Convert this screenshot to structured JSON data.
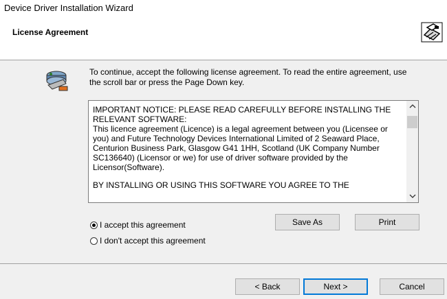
{
  "window": {
    "title": "Device Driver Installation Wizard"
  },
  "header": {
    "title": "License Agreement",
    "icon": "installer-computer-icon"
  },
  "intro": "To continue, accept the following license agreement. To read the entire agreement, use the scroll bar or press the Page Down key.",
  "license": {
    "paragraph1": "IMPORTANT NOTICE: PLEASE READ CAREFULLY BEFORE INSTALLING THE RELEVANT SOFTWARE:\nThis licence agreement (Licence) is a legal agreement between you (Licensee or you) and Future Technology Devices International Limited of 2 Seaward Place, Centurion Business Park, Glasgow G41 1HH, Scotland (UK Company Number SC136640) (Licensor or we) for use of driver software provided by the Licensor(Software).",
    "paragraph2": "BY INSTALLING OR USING THIS SOFTWARE YOU AGREE TO THE",
    "scroll_up": "^",
    "scroll_down": "v"
  },
  "options": {
    "accept_label": "I accept this agreement",
    "decline_label": "I don't accept this agreement",
    "selected": "accept"
  },
  "buttons": {
    "save_as": "Save As",
    "print": "Print",
    "back": "< Back",
    "next": "Next >",
    "cancel": "Cancel"
  }
}
